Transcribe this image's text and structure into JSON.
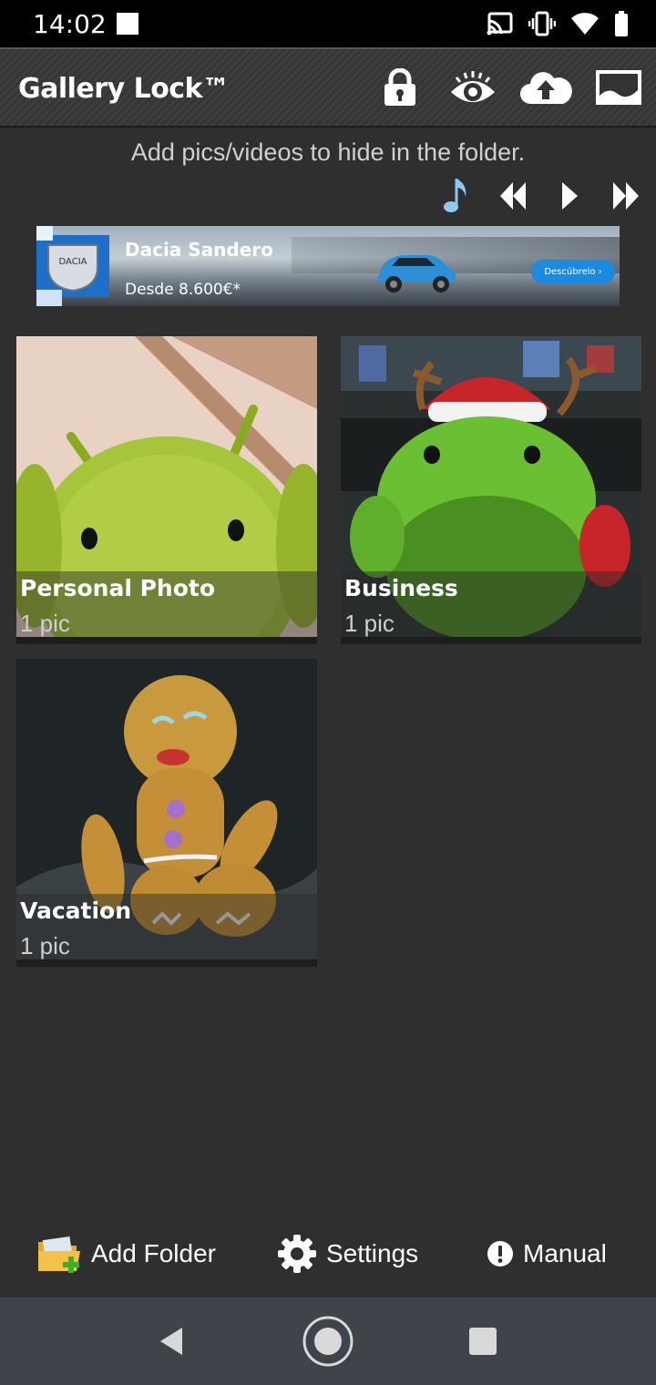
{
  "status_bar": {
    "time": "14:02",
    "icons": [
      "notification-square-icon",
      "cast-icon",
      "vibrate-icon",
      "wifi-icon",
      "battery-icon"
    ]
  },
  "app_bar": {
    "title": "Gallery Lock™",
    "actions": [
      "lock-icon",
      "eye-icon",
      "cloud-upload-icon",
      "gallery-icon"
    ]
  },
  "hint": "Add pics/videos to hide in the folder.",
  "player": {
    "controls": [
      "music-note-icon",
      "rewind-icon",
      "play-icon",
      "fast-forward-icon"
    ],
    "accent": "#8fc8ec"
  },
  "ad": {
    "title": "Dacia Sandero",
    "price": "Desde 8.600€*",
    "logo_text": "DACIA",
    "cta": "Descúbrelo  ›",
    "accent": "#1d6fc9"
  },
  "folders": [
    {
      "name": "Personal Photo",
      "count": "1 pic"
    },
    {
      "name": "Business",
      "count": "1 pic"
    },
    {
      "name": "Vacation",
      "count": "1 pic"
    }
  ],
  "bottom_actions": {
    "add_folder": "Add Folder",
    "settings": "Settings",
    "manual": "Manual"
  },
  "colors": {
    "background": "#2f2f2f",
    "nav_bar": "#3e4449",
    "android_green": "#9cc634"
  }
}
